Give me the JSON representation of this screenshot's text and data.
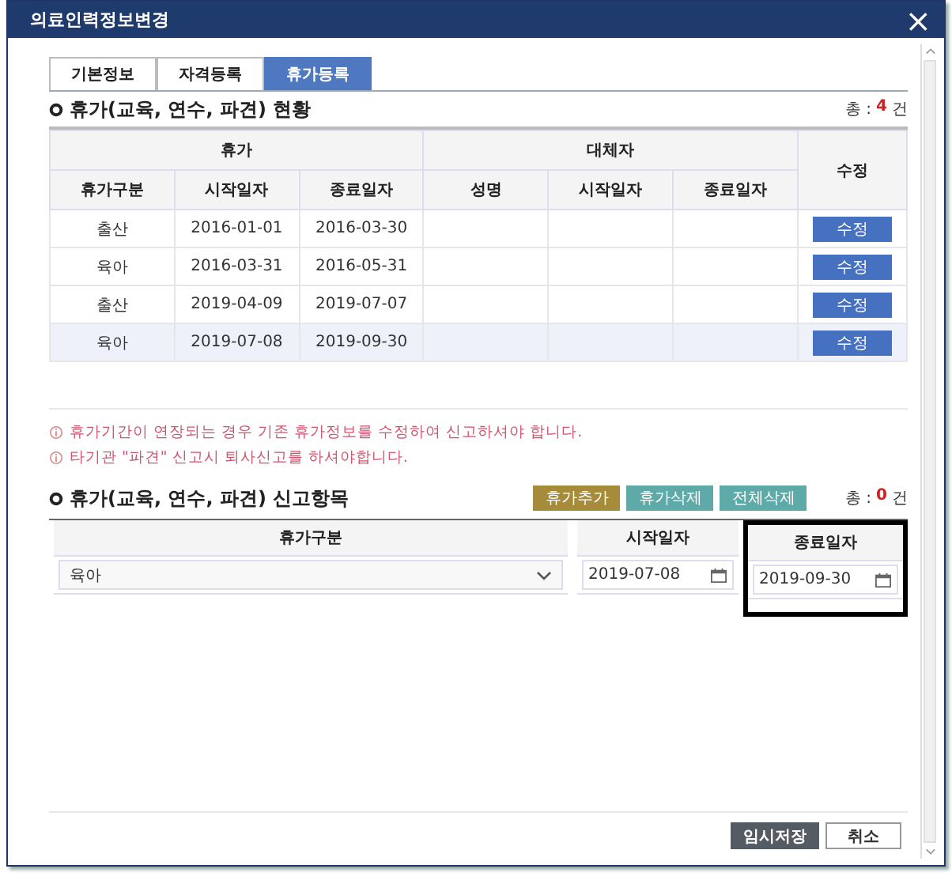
{
  "window": {
    "title": "의료인력정보변경",
    "close": "×"
  },
  "tabs": [
    {
      "label": "기본정보",
      "selected": false
    },
    {
      "label": "자격등록",
      "selected": false
    },
    {
      "label": "휴가등록",
      "selected": true
    }
  ],
  "status_section": {
    "title": "휴가(교육, 연수, 파견) 현황",
    "total": {
      "label": "총 :",
      "count": "4",
      "unit": "건"
    },
    "groups": [
      "휴가",
      "대체자",
      "수정"
    ],
    "columns": [
      "휴가구분",
      "시작일자",
      "종료일자",
      "성명",
      "시작일자",
      "종료일자"
    ],
    "rows": [
      {
        "type": "출산",
        "start": "2016-01-01",
        "end": "2016-03-30",
        "edit": "수정",
        "selected": false
      },
      {
        "type": "육아",
        "start": "2016-03-31",
        "end": "2016-05-31",
        "edit": "수정",
        "selected": false
      },
      {
        "type": "출산",
        "start": "2019-04-09",
        "end": "2019-07-07",
        "edit": "수정",
        "selected": false
      },
      {
        "type": "육아",
        "start": "2019-07-08",
        "end": "2019-09-30",
        "edit": "수정",
        "selected": true
      }
    ]
  },
  "notes": [
    "휴가기간이 연장되는 경우 기존 휴가정보를 수정하여 신고하셔야 합니다.",
    "타기관 \"파견\" 신고시 퇴사신고를 하셔야합니다."
  ],
  "report_section": {
    "title": "휴가(교육, 연수, 파견) 신고항목",
    "buttons": [
      {
        "label": "휴가추가",
        "color": "#a58b3a"
      },
      {
        "label": "휴가삭제",
        "color": "#5eaaa9"
      },
      {
        "label": "전체삭제",
        "color": "#5eaaa9"
      }
    ],
    "total": {
      "label": "총 :",
      "count": "0",
      "unit": "건"
    },
    "columns": [
      {
        "label": "휴가구분",
        "highlighted": false
      },
      {
        "label": "시작일자",
        "highlighted": false
      },
      {
        "label": "종료일자",
        "highlighted": true
      }
    ],
    "row": {
      "type": "육아",
      "start": "2019-07-08",
      "end": "2019-09-30"
    }
  },
  "footer_buttons": [
    {
      "label": "임시저장",
      "kind": "primary"
    },
    {
      "label": "취소",
      "kind": "secondary"
    }
  ]
}
